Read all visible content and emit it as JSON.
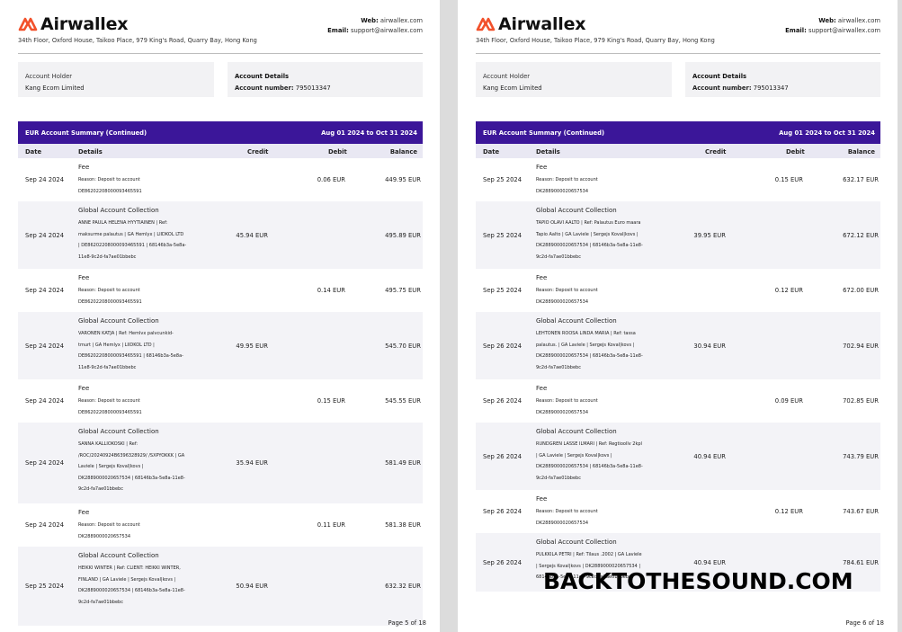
{
  "brand": "Airwallex",
  "brand_color": "#f2512b",
  "header": {
    "address": "34th Floor, Oxford House, Taikoo Place, 979 King's Road, Quarry Bay, Hong Kong",
    "web_label": "Web:",
    "web_value": "airwallex.com",
    "email_label": "Email:",
    "email_value": "support@airwallex.com"
  },
  "account": {
    "holder_label": "Account Holder",
    "holder_name": "Kang Ecom Limited",
    "details_label": "Account Details",
    "number_label": "Account number:",
    "number_value": "795013347"
  },
  "summary": {
    "title": "EUR Account Summary (Continued)",
    "date_range": "Aug 01 2024 to Oct 31 2024",
    "band_color": "#3b1699"
  },
  "columns": {
    "date": "Date",
    "details": "Details",
    "credit": "Credit",
    "debit": "Debit",
    "balance": "Balance"
  },
  "pages": [
    {
      "page_label": "Page 5 of 18",
      "rows": [
        {
          "date": "Sep 24 2024",
          "title": "Fee",
          "lines": [
            "Reason: Deposit to account",
            "DE86202208000093465591"
          ],
          "credit": "",
          "debit": "0.06 EUR",
          "balance": "449.95 EUR"
        },
        {
          "date": "Sep 24 2024",
          "title": "Global Account Collection",
          "lines": [
            "ANNE PAULA HELENA HYYTIAINEN | Ref:",
            "maksurme palautus | GA Hemlyx | LIIDKOL LTD",
            "| DE86202208000093465591 | 6814​6b3a-5e8a-",
            "11e8-9c2d-fa7ae01bbebc"
          ],
          "credit": "45.94 EUR",
          "debit": "",
          "balance": "495.89 EUR"
        },
        {
          "date": "Sep 24 2024",
          "title": "Fee",
          "lines": [
            "Reason: Deposit to account",
            "DE86202208000093465591"
          ],
          "credit": "",
          "debit": "0.14 EUR",
          "balance": "495.75 EUR"
        },
        {
          "date": "Sep 24 2024",
          "title": "Global Account Collection",
          "lines": [
            "VARONEN KATJA | Ref: Hemlvx palvcunkid-",
            "tmurt | GA Hemlyx | LIIDKOL LTD |",
            "DE86202208000093465591 | 6814​6b3a-5e8a-",
            "11e8-9c2d-fa7ae01bbebc"
          ],
          "credit": "49.95 EUR",
          "debit": "",
          "balance": "545.70 EUR"
        },
        {
          "date": "Sep 24 2024",
          "title": "Fee",
          "lines": [
            "Reason: Deposit to account",
            "DE86202208000093465591"
          ],
          "credit": "",
          "debit": "0.15 EUR",
          "balance": "545.55 EUR"
        },
        {
          "date": "Sep 24 2024",
          "title": "Global Account Collection",
          "lines": [
            "SANNA KALLIOKOSKI | Ref:",
            "/ROC/20240924B6396328929/ /SXPYOKKK | GA",
            "Laviele | Sergejs Koval|kovs |",
            "DK2889000020657534 | 6814​6b3a-5e8a-11e8-",
            "9c2d-fa7ae01bbebc"
          ],
          "credit": "35.94 EUR",
          "debit": "",
          "balance": "581.49 EUR"
        },
        {
          "date": "Sep 24 2024",
          "title": "Fee",
          "lines": [
            "Reason: Deposit to account",
            "DK2889000020657534"
          ],
          "credit": "",
          "debit": "0.11 EUR",
          "balance": "581.38 EUR"
        },
        {
          "date": "Sep 25 2024",
          "title": "Global Account Collection",
          "lines": [
            "HEIKKI WINTER | Ref: CLIENT: HEIKKI WINTER,",
            "FINLAND | GA Laviele | Sergejs Koval|kovs |",
            "DK2889000020657534 | 6814​6b3a-5e8a-11e8-",
            "9c2d-fa7ae01bbebc"
          ],
          "credit": "50.94 EUR",
          "debit": "",
          "balance": "632.32 EUR"
        }
      ]
    },
    {
      "page_label": "Page 6 of 18",
      "rows": [
        {
          "date": "Sep 25 2024",
          "title": "Fee",
          "lines": [
            "Reason: Deposit to account",
            "DK2889000020657534"
          ],
          "credit": "",
          "debit": "0.15 EUR",
          "balance": "632.17 EUR"
        },
        {
          "date": "Sep 25 2024",
          "title": "Global Account Collection",
          "lines": [
            "TAPIO OLAVI AALTO | Ref: Palautus Euro maara",
            "Tapio Aalto | GA Laviele | Sergejs Koval|kovs |",
            "DK2889000020657534 | 6814​6b3a-5e8a-11e8-",
            "9c2d-fa7ae01bbebc"
          ],
          "credit": "39.95 EUR",
          "debit": "",
          "balance": "672.12 EUR"
        },
        {
          "date": "Sep 25 2024",
          "title": "Fee",
          "lines": [
            "Reason: Deposit to account",
            "DK2889000020657534"
          ],
          "credit": "",
          "debit": "0.12 EUR",
          "balance": "672.00 EUR"
        },
        {
          "date": "Sep 26 2024",
          "title": "Global Account Collection",
          "lines": [
            "LEHTONEN ROOSA LINDA MARIA | Ref: tassa",
            "palautus. | GA Laviele | Sergejs Koval|kovs |",
            "DK2889000020657534 | 6814​6b3a-5e8a-11e8-",
            "9c2d-fa7ae01bbebc"
          ],
          "credit": "30.94 EUR",
          "debit": "",
          "balance": "702.94 EUR"
        },
        {
          "date": "Sep 26 2024",
          "title": "Fee",
          "lines": [
            "Reason: Deposit to account",
            "DK2889000020657534"
          ],
          "credit": "",
          "debit": "0.09 EUR",
          "balance": "702.85 EUR"
        },
        {
          "date": "Sep 26 2024",
          "title": "Global Account Collection",
          "lines": [
            "RUNDGREN LASSE ILMARI | Ref: Regtioollv 2kpl",
            "| GA Laviele | Sergejs Koval|kovs |",
            "DK2889000020657534 | 6814​6b3a-5e8a-11e8-",
            "9c2d-fa7ae01bbebc"
          ],
          "credit": "40.94 EUR",
          "debit": "",
          "balance": "743.79 EUR"
        },
        {
          "date": "Sep 26 2024",
          "title": "Fee",
          "lines": [
            "Reason: Deposit to account",
            "DK2889000020657534"
          ],
          "credit": "",
          "debit": "0.12 EUR",
          "balance": "743.67 EUR"
        },
        {
          "date": "Sep 26 2024",
          "title": "Global Account Collection",
          "lines": [
            "PULKKILA PETRI | Ref: Tilaus .2002 | GA Laviele",
            "| Sergejs Koval|kovs | DK2889000020657534 |",
            "6814​6b3a-5e8a-11e8-9c2d-fa7ae01bbebc"
          ],
          "credit": "40.94 EUR",
          "debit": "",
          "balance": "784.61 EUR"
        }
      ]
    }
  ],
  "watermark": "BACKTOTHESOUND.COM"
}
